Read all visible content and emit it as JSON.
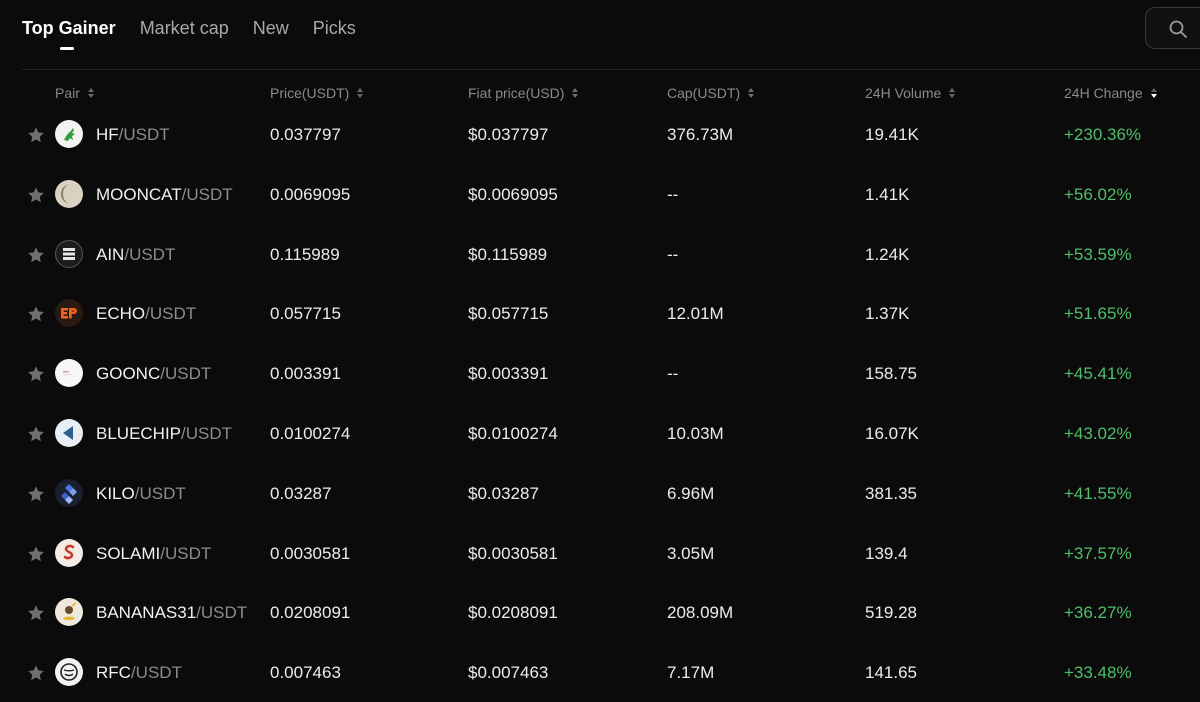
{
  "tabs": [
    {
      "label": "Top Gainer",
      "active": true
    },
    {
      "label": "Market cap",
      "active": false
    },
    {
      "label": "New",
      "active": false
    },
    {
      "label": "Picks",
      "active": false
    }
  ],
  "search": {
    "icon": "search-icon"
  },
  "columns": [
    "Pair",
    "Price(USDT)",
    "Fiat price(USD)",
    "Cap(USDT)",
    "24H Volume",
    "24H Change"
  ],
  "sort_column": "24H Change",
  "sort_direction": "descending",
  "colors": {
    "positive": "#4fbf6b",
    "background": "#0b0b0b"
  },
  "rows": [
    {
      "base": "HF",
      "quote": "/USDT",
      "price": "0.037797",
      "fiat": "$0.037797",
      "cap": "376.73M",
      "volume": "19.41K",
      "change": "+230.36%"
    },
    {
      "base": "MOONCAT",
      "quote": "/USDT",
      "price": "0.0069095",
      "fiat": "$0.0069095",
      "cap": "--",
      "volume": "1.41K",
      "change": "+56.02%"
    },
    {
      "base": "AIN",
      "quote": "/USDT",
      "price": "0.115989",
      "fiat": "$0.115989",
      "cap": "--",
      "volume": "1.24K",
      "change": "+53.59%"
    },
    {
      "base": "ECHO",
      "quote": "/USDT",
      "price": "0.057715",
      "fiat": "$0.057715",
      "cap": "12.01M",
      "volume": "1.37K",
      "change": "+51.65%"
    },
    {
      "base": "GOONC",
      "quote": "/USDT",
      "price": "0.003391",
      "fiat": "$0.003391",
      "cap": "--",
      "volume": "158.75",
      "change": "+45.41%"
    },
    {
      "base": "BLUECHIP",
      "quote": "/USDT",
      "price": "0.0100274",
      "fiat": "$0.0100274",
      "cap": "10.03M",
      "volume": "16.07K",
      "change": "+43.02%"
    },
    {
      "base": "KILO",
      "quote": "/USDT",
      "price": "0.03287",
      "fiat": "$0.03287",
      "cap": "6.96M",
      "volume": "381.35",
      "change": "+41.55%"
    },
    {
      "base": "SOLAMI",
      "quote": "/USDT",
      "price": "0.0030581",
      "fiat": "$0.0030581",
      "cap": "3.05M",
      "volume": "139.4",
      "change": "+37.57%"
    },
    {
      "base": "BANANAS31",
      "quote": "/USDT",
      "price": "0.0208091",
      "fiat": "$0.0208091",
      "cap": "208.09M",
      "volume": "519.28",
      "change": "+36.27%"
    },
    {
      "base": "RFC",
      "quote": "/USDT",
      "price": "0.007463",
      "fiat": "$0.007463",
      "cap": "7.17M",
      "volume": "141.65",
      "change": "+33.48%"
    }
  ]
}
